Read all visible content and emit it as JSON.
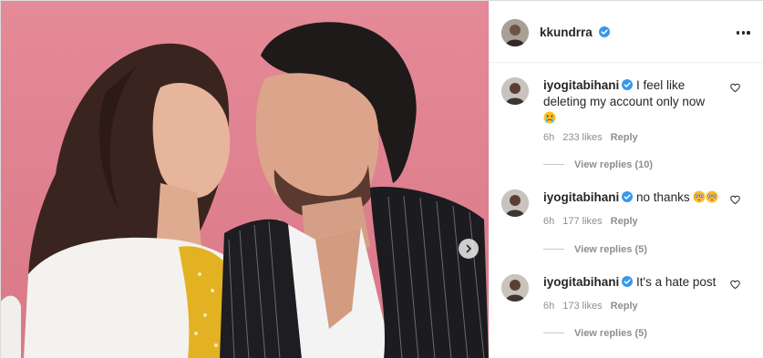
{
  "post": {
    "author": {
      "username": "kkundrra",
      "verified": true,
      "avatar_icon": "profile-avatar"
    },
    "more_icon": "more-horizontal-icon",
    "next_icon": "chevron-right-icon"
  },
  "comments": [
    {
      "username": "iyogitabihani",
      "verified": true,
      "text": "I feel like deleting my account only now",
      "emoji": [
        "crying-face-emoji"
      ],
      "time": "6h",
      "likes": "233 likes",
      "reply_label": "Reply",
      "view_replies": "View replies (10)"
    },
    {
      "username": "iyogitabihani",
      "verified": true,
      "text": "no thanks",
      "emoji": [
        "flushed-face-emoji",
        "flushed-face-emoji"
      ],
      "time": "6h",
      "likes": "177 likes",
      "reply_label": "Reply",
      "view_replies": "View replies (5)"
    },
    {
      "username": "iyogitabihani",
      "verified": true,
      "text": "It's a hate post",
      "emoji": [],
      "time": "6h",
      "likes": "173 likes",
      "reply_label": "Reply",
      "view_replies": "View replies (5)"
    }
  ],
  "colors": {
    "verified_blue": "#3897f0",
    "meta_gray": "#8e8e8e",
    "photo_background": "#e0828f"
  }
}
